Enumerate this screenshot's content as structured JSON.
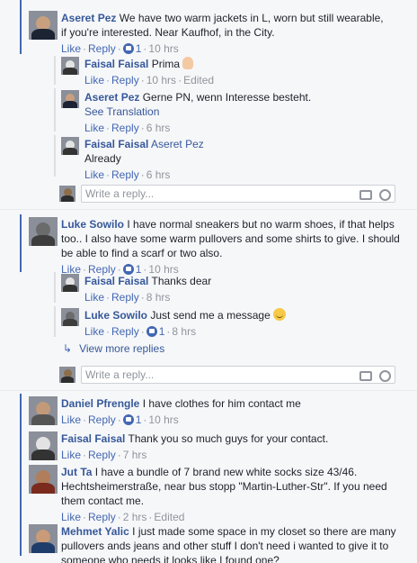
{
  "threads": [
    {
      "author": "Aseret Pez",
      "text": "We have two warm jackets in L, worn but still wearable, if you're interested. Near Kaufhof, in the City.",
      "like": "Like",
      "reply": "Reply",
      "likes": "1",
      "time": "10 hrs"
    },
    {
      "author": "Luke Sowilo",
      "text": "I have normal sneakers but no warm shoes, if that helps too.. I also have some warm pullovers and some shirts to give. I should be able to find a scarf or two also.",
      "like": "Like",
      "reply": "Reply",
      "likes": "1",
      "time": "10 hrs"
    }
  ],
  "replies1": [
    {
      "author": "Faisal Faisal",
      "text": "Prima",
      "like": "Like",
      "reply": "Reply",
      "time": "10 hrs",
      "edited": "Edited"
    },
    {
      "author": "Aseret Pez",
      "text": "Gerne PN, wenn Interesse besteht.",
      "translate": "See Translation",
      "like": "Like",
      "reply": "Reply",
      "time": "6 hrs"
    },
    {
      "author": "Faisal Faisal",
      "tag": "Aseret Pez",
      "text": "Already",
      "like": "Like",
      "reply": "Reply",
      "time": "6 hrs"
    }
  ],
  "replies2": [
    {
      "author": "Faisal Faisal",
      "text": "Thanks dear",
      "like": "Like",
      "reply": "Reply",
      "time": "8 hrs"
    },
    {
      "author": "Luke Sowilo",
      "text": "Just send me a message",
      "like": "Like",
      "reply": "Reply",
      "likes": "1",
      "time": "8 hrs"
    }
  ],
  "view_more": "View more replies",
  "write_placeholder": "Write a reply...",
  "others": [
    {
      "author": "Daniel Pfrengle",
      "text": "I have clothes for him contact me",
      "like": "Like",
      "reply": "Reply",
      "likes": "1",
      "time": "10 hrs"
    },
    {
      "author": "Faisal Faisal",
      "text": "Thank you so much guys for your contact.",
      "like": "Like",
      "reply": "Reply",
      "time": "7 hrs"
    },
    {
      "author": "Jut Ta",
      "text": "I have a bundle of 7 brand new white socks size 43/46. Hechtsheimerstraße, near bus stopp \"Martin-Luther-Str\". If you need them contact me.",
      "like": "Like",
      "reply": "Reply",
      "time": "2 hrs",
      "edited": "Edited"
    },
    {
      "author": "Mehmet Yalic",
      "text": "I just made some space in my closet so there are many pullovers ands jeans and other stuff I don't need i wanted to give it to someone who needs it looks like I found one?"
    }
  ],
  "colors": {
    "link": "#365899",
    "accent": "#4267b2",
    "meta": "#90949c",
    "bg": "#f6f7f9"
  }
}
